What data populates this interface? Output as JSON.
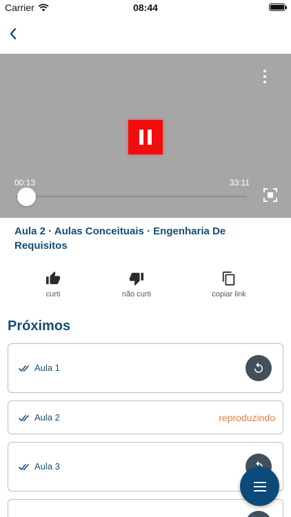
{
  "status_bar": {
    "carrier": "Carrier",
    "time": "08:44"
  },
  "nav": {
    "back_icon": "chevron-left-icon"
  },
  "player": {
    "current_time": "00:13",
    "total_time": "33:11",
    "progress_fraction": 0.0065,
    "state": "playing",
    "accent_color": "#f20d0d"
  },
  "lesson": {
    "title": "Aula 2 · Aulas Conceituais · Engenharia De Requisitos"
  },
  "actions": {
    "like": "curti",
    "dislike": "não curti",
    "copy_link": "copiar link"
  },
  "next": {
    "title": "Próximos",
    "items": [
      {
        "name": "Aula 1",
        "status": "",
        "action": "replay"
      },
      {
        "name": "Aula 2",
        "status": "reproduzindo",
        "action": ""
      },
      {
        "name": "Aula 3",
        "status": "",
        "action": "replay"
      }
    ]
  },
  "colors": {
    "primary": "#144d75",
    "playing_status": "#e87d3e",
    "fab": "#0b4a79"
  }
}
